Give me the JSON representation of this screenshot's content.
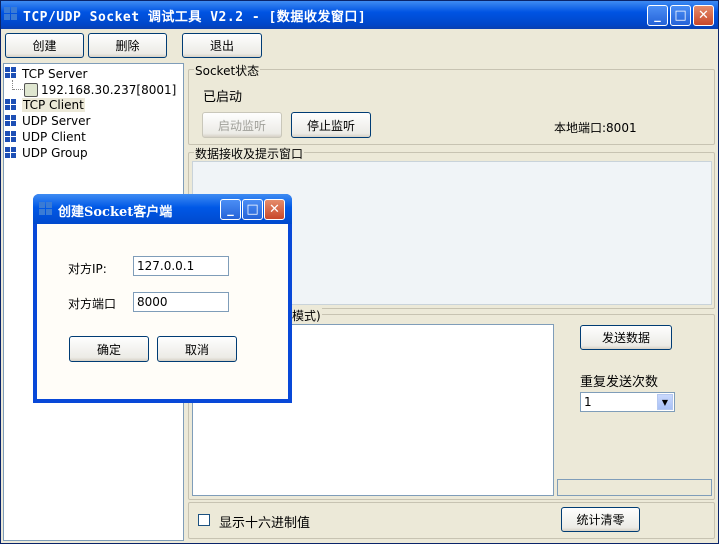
{
  "window": {
    "title": "TCP/UDP Socket 调试工具 V2.2 - [数据收发窗口]",
    "controls": {
      "minimize": "_",
      "maximize": "□",
      "close": "✕"
    }
  },
  "toolbar": {
    "create": "创建",
    "delete": "删除",
    "exit": "退出"
  },
  "tree": {
    "items": [
      {
        "label": "TCP Server"
      },
      {
        "label": "192.168.30.237[8001]"
      },
      {
        "label": "TCP Client"
      },
      {
        "label": "UDP Server"
      },
      {
        "label": "UDP Client"
      },
      {
        "label": "UDP Group"
      }
    ]
  },
  "socket_status": {
    "legend": "Socket状态",
    "state": "已启动",
    "start_listen": "启动监听",
    "stop_listen": "停止监听",
    "local_port": "本地端口:8001"
  },
  "receive": {
    "legend": "数据接收及提示窗口"
  },
  "send": {
    "legend_partial": "模式)",
    "send_button": "发送数据",
    "repeat_label": "重复发送次数",
    "repeat_value": "1",
    "hex_label": "显示十六进制值",
    "clear_stats": "统计清零"
  },
  "dialog": {
    "title": "创建Socket客户端",
    "ip_label": "对方IP:",
    "ip_value": "127.0.0.1",
    "port_label": "对方端口",
    "port_value": "8000",
    "ok": "确定",
    "cancel": "取消"
  },
  "colors": {
    "titlebar": "#0054e3",
    "window_bg": "#ece9d8",
    "selected_tree_bg": "#ece9d8"
  }
}
